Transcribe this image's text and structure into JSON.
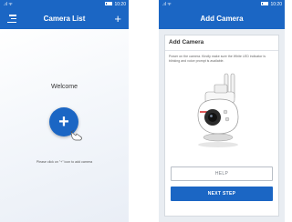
{
  "status_bar": {
    "signal": ".ıl ᯤ",
    "time": "10:20"
  },
  "left_screen": {
    "title": "Camera List",
    "menu_icon": "hamburger-menu-icon",
    "add_label": "+",
    "welcome": "Welcome",
    "add_circle_label": "+",
    "hint": "Please click on \"+\" icon to add camera"
  },
  "right_screen": {
    "title": "Add Camera",
    "card_title": "Add Camera",
    "description": "Power on the camera. Kindly make sure the White LED indicator is blinking and voice prompt is available.",
    "help_label": "HELP",
    "next_label": "NEXT STEP"
  },
  "colors": {
    "brand": "#1b66c4",
    "background": "#e9edf2"
  }
}
